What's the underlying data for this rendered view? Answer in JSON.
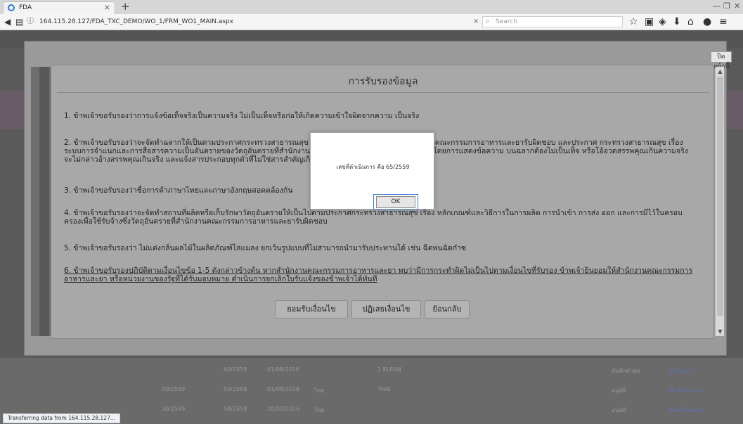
{
  "browser": {
    "tab_title": "FDA",
    "tab_close": "×",
    "new_tab": "+",
    "url": "164.115.28.127/FDA_TXC_DEMO/WO_1/FRM_WO1_MAIN.aspx",
    "url_clear": "×",
    "search_placeholder": "Search",
    "status_text": "Transferring data from 164.115.28.127..."
  },
  "page": {
    "close_page_label": "ปิดหน้านี้",
    "rows": [
      {
        "c1": "",
        "c2": "60/2559",
        "c3": "01/08/2016",
        "c4": "",
        "c5": "1 KLEAN",
        "c6": "บันทึกคำขอ",
        "c7": "ดำเนินการ"
      },
      {
        "c1": "30/2559",
        "c2": "59/2559",
        "c3": "01/08/2016",
        "c4": "ไทย",
        "c5": "THAI",
        "c6": "อนุมัติ",
        "c7": "พิมพ์ใบรับแจ้ง"
      },
      {
        "c1": "30/2559",
        "c2": "58/2559",
        "c3": "20/07/2016",
        "c4": "ไทย",
        "c5": "",
        "c6": "อนุมัติ",
        "c7": "พิมพ์ใบรับแจ้ง"
      }
    ]
  },
  "dialog": {
    "title": "การรับรองข้อมูล",
    "items": [
      "1. ข้าพเจ้าขอรับรองว่าการแจ้งข้อเท็จจริงเป็นความจริง ไม่เป็นเท็จหรือก่อให้เกิดความเข้าใจผิดจากความ เป็นจริง",
      "2. ข้าพเจ้าขอรับรองว่าจะจัดทำฉลากให้เป็นตามประกาศกระทรวงสาธารณสุข เรื่อง ฉลากของวัตถุอันตรายที่สำนักงานคณะกรรมการอาหารและยารับผิดชอบ และประกาศ กระทรวงสาธารณสุข เรื่อง ระบบการจำแนกและการสื่อสารความเป็นอันตรายของวัตถุอันตรายที่สำนักงานคณะกรรมการอาหารและยารับผิดชอบ โดยการแสดงข้อความ บนฉลากต้องไม่เป็นเท็จ หรือโอ้อวดสรรพคุณเกินความจริง จะไม่กล่าวอ้างสรรพคุณเกินจริง และแจ้งสารประกอบทุกตัวที่ไม่ใช่สารสำคัญเกินกว่าหน้าที่ที่ได้แจ้งไว้",
      "3. ข้าพเจ้าขอรับรองว่าชื่อการค้าภาษาไทยและภาษาอังกฤษสอดคล้องกัน",
      "4. ข้าพเจ้าขอรับรองว่าจะจัดทำสถานที่ผลิตหรือเก็บรักษาวัตถุอันตรายให้เป็นไปตามประกาศกระทรวงสาธารณสุข เรื่อง หลักเกณฑ์และวิธีการในการผลิต การนำเข้า การส่ง ออก และการมีไว้ในครอบครองเพื่อใช้รับจ้างซึ่งวัตถุอันตรายที่สำนักงานคณะกรรมการอาหารและยารับผิดชอบ",
      "5. ข้าพเจ้าขอรับรองว่า ไม่แต่งกลิ่นผลไม้ในผลิตภัณฑ์ไล่แมลง ยกเว้นรูปแบบที่ไม่สามารถนำมารับประทานได้ เช่น ฉีดพ่นฉัดกำซ",
      "6. ข้าพเจ้าขอรับรองปฏิบัติตามเงื่อนไขข้อ 1-5 ดังกล่าวข้างต้น หากสำนักงานคณะกรรมการอาหารและยา พบว่ามีการกระทำผิดไม่เป็นไปตามเงื่อนไขที่รับรอง ข้าพเจ้ายินยอมให้สำนักงานคณะกรรมการอาหารและยา หรือหน่วยงานของรัฐที่ได้รับมอบหมาย ดำเนินการยกเลิกใบรับแจ้งของข้าพเจ้าได้ทันที"
    ],
    "buttons": {
      "accept": "ยอมรับเงื่อนไข",
      "reject": "ปฏิเสธเงื่อนไข",
      "back": "ย้อนกลับ"
    }
  },
  "alert": {
    "message": "เลขที่ดำเนินการ คือ 65/2559",
    "ok_label": "OK"
  }
}
